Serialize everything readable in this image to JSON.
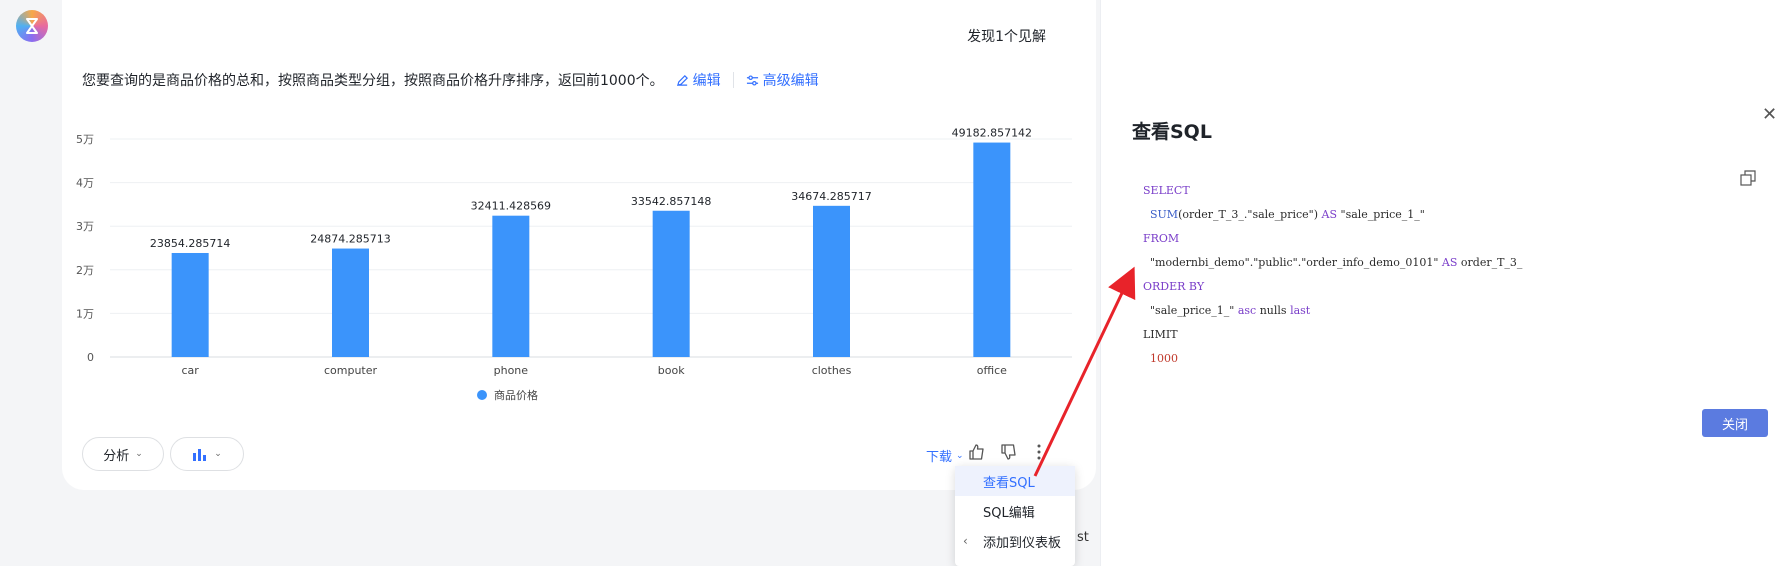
{
  "header": {
    "insight_text": "发现1个见解"
  },
  "summary": {
    "text": "您要查询的是商品价格的总和，按照商品类型分组，按照商品价格升序排序，返回前1000个。",
    "edit_label": "编辑",
    "advanced_edit_label": "高级编辑"
  },
  "chart_data": {
    "type": "bar",
    "categories": [
      "car",
      "computer",
      "phone",
      "book",
      "clothes",
      "office"
    ],
    "series": [
      {
        "name": "商品价格",
        "values": [
          23854.285714,
          24874.285713,
          32411.428569,
          33542.857148,
          34674.285717,
          49182.857142
        ]
      }
    ],
    "data_labels": [
      "23854.285714",
      "24874.285713",
      "32411.428569",
      "33542.857148",
      "34674.285717",
      "49182.857142"
    ],
    "ylim": [
      0,
      50000
    ],
    "yticks": [
      0,
      10000,
      20000,
      30000,
      40000,
      50000
    ],
    "ytick_labels": [
      "0",
      "1万",
      "2万",
      "3万",
      "4万",
      "5万"
    ],
    "color": "#3b94fb",
    "legend_position": "bottom-center",
    "grid": true
  },
  "footer": {
    "analyze_label": "分析",
    "download_label": "下载"
  },
  "dropdown": {
    "items": [
      "查看SQL",
      "SQL编辑",
      "添加到仪表板"
    ]
  },
  "behind_text": "st",
  "sql_panel": {
    "title": "查看SQL",
    "close_button_label": "关闭",
    "sql": {
      "select_kw": "SELECT",
      "sum_fn": "SUM",
      "select_rest": "(order_T_3_.\"sale_price\")",
      "as1": "AS",
      "alias1": "\"sale_price_1_\"",
      "from_kw": "FROM",
      "table": "\"modernbi_demo\".\"public\".\"order_info_demo_0101\"",
      "as2": "AS",
      "alias2": "order_T_3_",
      "order_kw": "ORDER BY",
      "order_col": "\"sale_price_1_\"",
      "asc_kw": "asc",
      "nulls": "nulls",
      "last_kw": "last",
      "limit_kw": "LIMIT",
      "limit_val": "1000"
    }
  }
}
